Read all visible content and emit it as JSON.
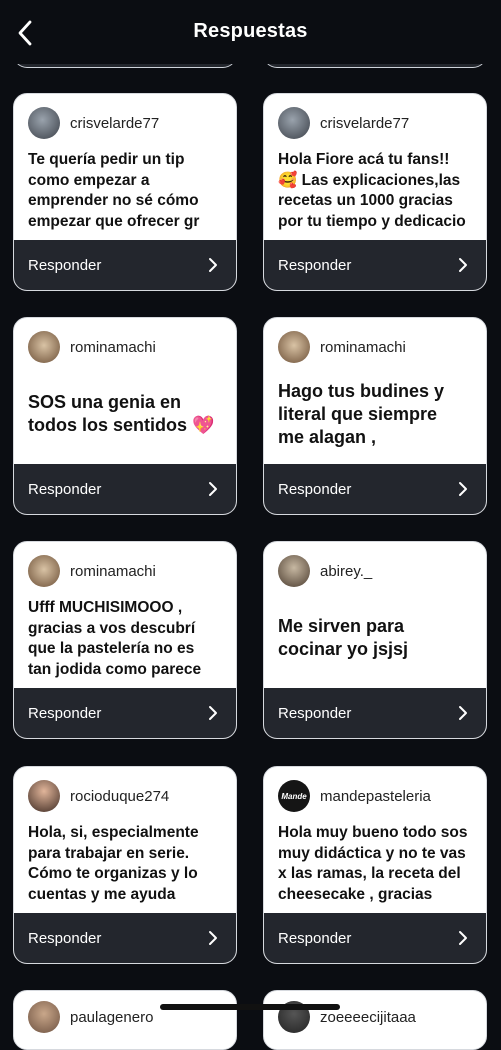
{
  "header": {
    "title": "Respuestas",
    "back_icon": "chevron-left-icon"
  },
  "reply_label": "Responder",
  "cards": [
    {
      "user": "crisvelarde77",
      "message": "Te quería pedir un tip\ncomo empezar a\nemprender no sé cómo\nempezar que ofrecer gr",
      "avatar": "photo"
    },
    {
      "user": "crisvelarde77",
      "message": "Hola Fiore acá tu fans!!\n🥰 Las explicaciones,las\nrecetas un 1000 gracias\npor tu tiempo y dedicacio",
      "avatar": "photo"
    },
    {
      "user": "rominamachi",
      "message": "SOS una genia en\ntodos los sentidos 💖",
      "avatar": "photo"
    },
    {
      "user": "rominamachi",
      "message": "Hago tus budines y\nliteral que siempre\nme alagan ,",
      "avatar": "photo"
    },
    {
      "user": "rominamachi",
      "message": "Ufff MUCHISIMOOO ,\ngracias a vos descubrí\nque la pastelería no es\ntan jodida como parece",
      "avatar": "photo"
    },
    {
      "user": "abirey._",
      "message": "Me sirven para\ncocinar yo jsjsj",
      "avatar": "photo"
    },
    {
      "user": "rocioduque274",
      "message": "Hola, si, especialmente\npara trabajar en serie.\nCómo te organizas y lo\ncuentas y me ayuda",
      "avatar": "photo"
    },
    {
      "user": "mandepasteleria",
      "message": "Hola muy bueno todo sos\nmuy didáctica y no te vas\nx las ramas, la receta del\ncheesecake , gracias",
      "avatar": "logo",
      "avatar_text": "Mande"
    }
  ],
  "partial_cards": [
    {
      "user": "paulagenero"
    },
    {
      "user": "zoeeeecijitaaa"
    }
  ]
}
